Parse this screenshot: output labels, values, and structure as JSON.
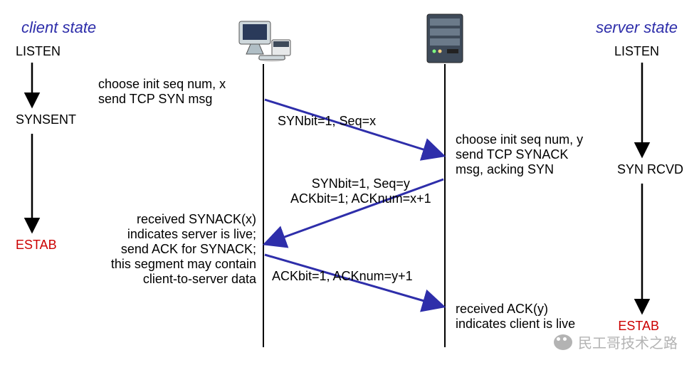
{
  "titles": {
    "client": "client state",
    "server": "server state"
  },
  "client_states": {
    "listen": "LISTEN",
    "synsent": "SYNSENT",
    "estab": "ESTAB"
  },
  "server_states": {
    "listen": "LISTEN",
    "synrcvd": "SYN RCVD",
    "estab": "ESTAB"
  },
  "client_notes": {
    "choose": "choose init seq num, x\nsend TCP SYN msg",
    "received": "received SYNACK(x)\nindicates server is live;\nsend ACK for SYNACK;\nthis segment may contain\nclient-to-server data"
  },
  "server_notes": {
    "choose": "choose init seq num, y\nsend TCP SYNACK\nmsg, acking SYN",
    "received": "received ACK(y)\nindicates client is live"
  },
  "messages": {
    "syn": "SYNbit=1, Seq=x",
    "synack": "SYNbit=1, Seq=y\nACKbit=1; ACKnum=x+1",
    "ack": "ACKbit=1, ACKnum=y+1"
  },
  "watermark": "民工哥技术之路"
}
